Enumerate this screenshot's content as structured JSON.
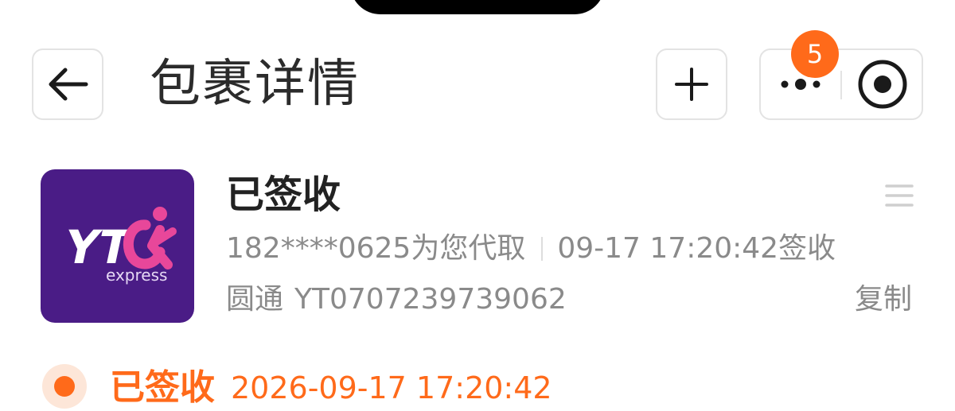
{
  "header": {
    "title": "包裹详情",
    "back_icon": "arrow-left-icon",
    "add_icon": "plus-icon",
    "more_icon": "more-dots-icon",
    "target_icon": "target-icon",
    "badge_count": "5"
  },
  "parcel": {
    "logo": {
      "brand_text": "YTOK",
      "sub_text": "express",
      "bg_color": "#4a1c86",
      "accent_color": "#e8479a"
    },
    "status": "已签收",
    "pickup_note": "182****0625为您代取",
    "signed_time": "09-17 17:20:42签收",
    "carrier": "圆通",
    "tracking_number": "YT0707239739062",
    "copy_label": "复制",
    "menu_icon": "list-menu-icon"
  },
  "timeline": [
    {
      "status": "已签收",
      "time": "2026-09-17 17:20:42",
      "color": "#ff6a1a"
    }
  ]
}
